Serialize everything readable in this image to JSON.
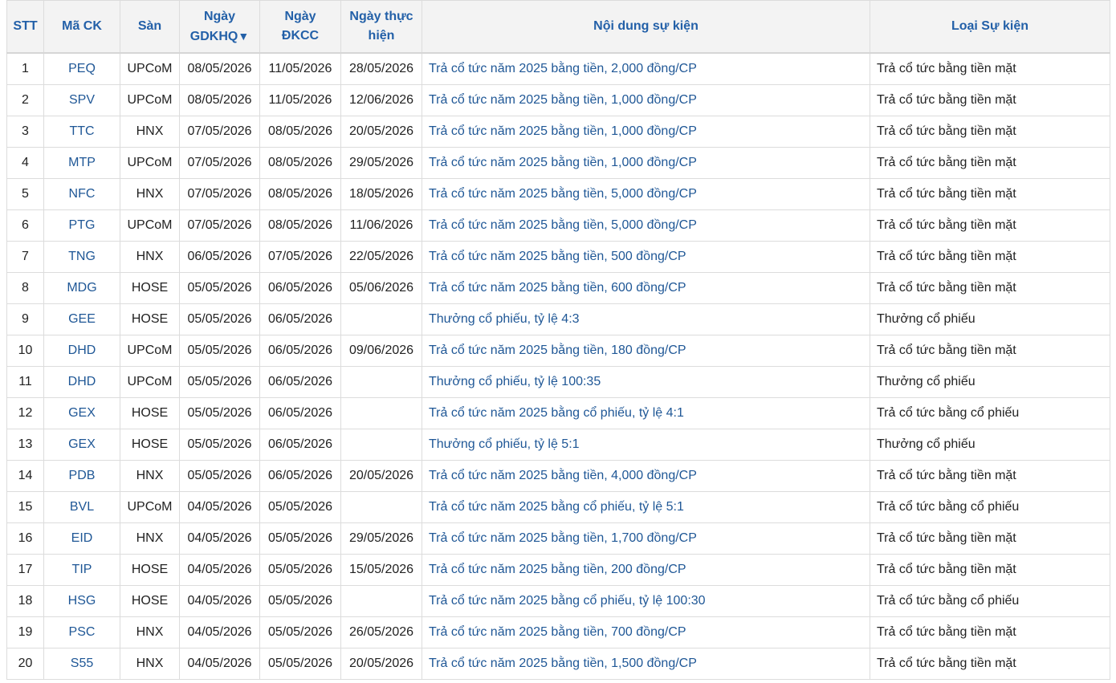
{
  "table": {
    "headers": {
      "stt": "STT",
      "code": "Mã CK",
      "exchange": "Sàn",
      "ex_date_line1": "Ngày",
      "ex_date_line2": "GDKHQ",
      "sort_arrow": "▼",
      "record_date_line1": "Ngày",
      "record_date_line2": "ĐKCC",
      "exec_date_line1": "Ngày thực",
      "exec_date_line2": "hiện",
      "content": "Nội dung sự kiện",
      "type": "Loại Sự kiện"
    },
    "rows": [
      {
        "stt": "1",
        "code": "PEQ",
        "exchange": "UPCoM",
        "ex_date": "08/05/2026",
        "record_date": "11/05/2026",
        "exec_date": "28/05/2026",
        "content": "Trả cổ tức năm 2025 bằng tiền, 2,000 đồng/CP",
        "type": "Trả cổ tức bằng tiền mặt"
      },
      {
        "stt": "2",
        "code": "SPV",
        "exchange": "UPCoM",
        "ex_date": "08/05/2026",
        "record_date": "11/05/2026",
        "exec_date": "12/06/2026",
        "content": "Trả cổ tức năm 2025 bằng tiền, 1,000 đồng/CP",
        "type": "Trả cổ tức bằng tiền mặt"
      },
      {
        "stt": "3",
        "code": "TTC",
        "exchange": "HNX",
        "ex_date": "07/05/2026",
        "record_date": "08/05/2026",
        "exec_date": "20/05/2026",
        "content": "Trả cổ tức năm 2025 bằng tiền, 1,000 đồng/CP",
        "type": "Trả cổ tức bằng tiền mặt"
      },
      {
        "stt": "4",
        "code": "MTP",
        "exchange": "UPCoM",
        "ex_date": "07/05/2026",
        "record_date": "08/05/2026",
        "exec_date": "29/05/2026",
        "content": "Trả cổ tức năm 2025 bằng tiền, 1,000 đồng/CP",
        "type": "Trả cổ tức bằng tiền mặt"
      },
      {
        "stt": "5",
        "code": "NFC",
        "exchange": "HNX",
        "ex_date": "07/05/2026",
        "record_date": "08/05/2026",
        "exec_date": "18/05/2026",
        "content": "Trả cổ tức năm 2025 bằng tiền, 5,000 đồng/CP",
        "type": "Trả cổ tức bằng tiền mặt"
      },
      {
        "stt": "6",
        "code": "PTG",
        "exchange": "UPCoM",
        "ex_date": "07/05/2026",
        "record_date": "08/05/2026",
        "exec_date": "11/06/2026",
        "content": "Trả cổ tức năm 2025 bằng tiền, 5,000 đồng/CP",
        "type": "Trả cổ tức bằng tiền mặt"
      },
      {
        "stt": "7",
        "code": "TNG",
        "exchange": "HNX",
        "ex_date": "06/05/2026",
        "record_date": "07/05/2026",
        "exec_date": "22/05/2026",
        "content": "Trả cổ tức năm 2025 bằng tiền, 500 đồng/CP",
        "type": "Trả cổ tức bằng tiền mặt"
      },
      {
        "stt": "8",
        "code": "MDG",
        "exchange": "HOSE",
        "ex_date": "05/05/2026",
        "record_date": "06/05/2026",
        "exec_date": "05/06/2026",
        "content": "Trả cổ tức năm 2025 bằng tiền, 600 đồng/CP",
        "type": "Trả cổ tức bằng tiền mặt"
      },
      {
        "stt": "9",
        "code": "GEE",
        "exchange": "HOSE",
        "ex_date": "05/05/2026",
        "record_date": "06/05/2026",
        "exec_date": "",
        "content": "Thưởng cổ phiếu, tỷ lệ 4:3",
        "type": "Thưởng cổ phiếu"
      },
      {
        "stt": "10",
        "code": "DHD",
        "exchange": "UPCoM",
        "ex_date": "05/05/2026",
        "record_date": "06/05/2026",
        "exec_date": "09/06/2026",
        "content": "Trả cổ tức năm 2025 bằng tiền, 180 đồng/CP",
        "type": "Trả cổ tức bằng tiền mặt"
      },
      {
        "stt": "11",
        "code": "DHD",
        "exchange": "UPCoM",
        "ex_date": "05/05/2026",
        "record_date": "06/05/2026",
        "exec_date": "",
        "content": "Thưởng cổ phiếu, tỷ lệ 100:35",
        "type": "Thưởng cổ phiếu"
      },
      {
        "stt": "12",
        "code": "GEX",
        "exchange": "HOSE",
        "ex_date": "05/05/2026",
        "record_date": "06/05/2026",
        "exec_date": "",
        "content": "Trả cổ tức năm 2025 bằng cổ phiếu, tỷ lệ 4:1",
        "type": "Trả cổ tức bằng cổ phiếu"
      },
      {
        "stt": "13",
        "code": "GEX",
        "exchange": "HOSE",
        "ex_date": "05/05/2026",
        "record_date": "06/05/2026",
        "exec_date": "",
        "content": "Thưởng cổ phiếu, tỷ lệ 5:1",
        "type": "Thưởng cổ phiếu"
      },
      {
        "stt": "14",
        "code": "PDB",
        "exchange": "HNX",
        "ex_date": "05/05/2026",
        "record_date": "06/05/2026",
        "exec_date": "20/05/2026",
        "content": "Trả cổ tức năm 2025 bằng tiền, 4,000 đồng/CP",
        "type": "Trả cổ tức bằng tiền mặt"
      },
      {
        "stt": "15",
        "code": "BVL",
        "exchange": "UPCoM",
        "ex_date": "04/05/2026",
        "record_date": "05/05/2026",
        "exec_date": "",
        "content": "Trả cổ tức năm 2025 bằng cổ phiếu, tỷ lệ 5:1",
        "type": "Trả cổ tức bằng cổ phiếu"
      },
      {
        "stt": "16",
        "code": "EID",
        "exchange": "HNX",
        "ex_date": "04/05/2026",
        "record_date": "05/05/2026",
        "exec_date": "29/05/2026",
        "content": "Trả cổ tức năm 2025 bằng tiền, 1,700 đồng/CP",
        "type": "Trả cổ tức bằng tiền mặt"
      },
      {
        "stt": "17",
        "code": "TIP",
        "exchange": "HOSE",
        "ex_date": "04/05/2026",
        "record_date": "05/05/2026",
        "exec_date": "15/05/2026",
        "content": "Trả cổ tức năm 2025 bằng tiền, 200 đồng/CP",
        "type": "Trả cổ tức bằng tiền mặt"
      },
      {
        "stt": "18",
        "code": "HSG",
        "exchange": "HOSE",
        "ex_date": "04/05/2026",
        "record_date": "05/05/2026",
        "exec_date": "",
        "content": "Trả cổ tức năm 2025 bằng cổ phiếu, tỷ lệ 100:30",
        "type": "Trả cổ tức bằng cổ phiếu"
      },
      {
        "stt": "19",
        "code": "PSC",
        "exchange": "HNX",
        "ex_date": "04/05/2026",
        "record_date": "05/05/2026",
        "exec_date": "26/05/2026",
        "content": "Trả cổ tức năm 2025 bằng tiền, 700 đồng/CP",
        "type": "Trả cổ tức bằng tiền mặt"
      },
      {
        "stt": "20",
        "code": "S55",
        "exchange": "HNX",
        "ex_date": "04/05/2026",
        "record_date": "05/05/2026",
        "exec_date": "20/05/2026",
        "content": "Trả cổ tức năm 2025 bằng tiền, 1,500 đồng/CP",
        "type": "Trả cổ tức bằng tiền mặt"
      }
    ]
  },
  "colors": {
    "header_bg": "#f3f3f3",
    "header_text": "#2360a8",
    "link_text": "#1f5796",
    "body_text": "#222222",
    "grid": "#dcdcdc"
  }
}
